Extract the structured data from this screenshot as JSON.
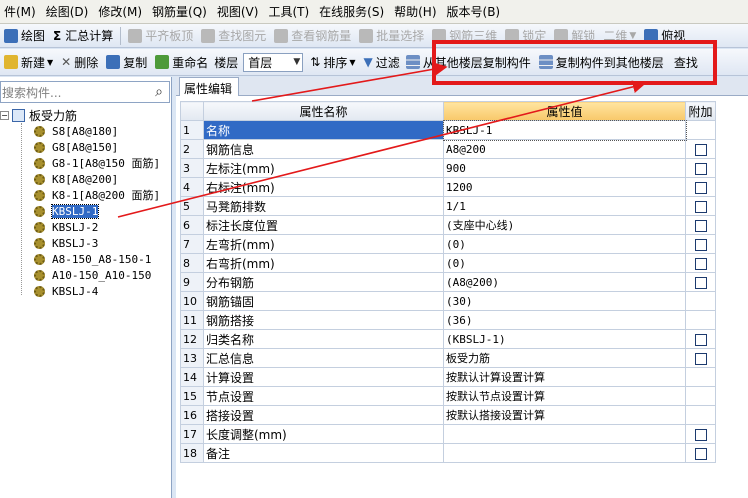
{
  "menu": [
    "件(M)",
    "绘图(D)",
    "修改(M)",
    "钢筋量(Q)",
    "视图(V)",
    "工具(T)",
    "在线服务(S)",
    "帮助(H)",
    "版本号(B)"
  ],
  "toolbar1": {
    "draw": "绘图",
    "sum_calc": "汇总计算",
    "flat_board": "平齐板顶",
    "find_element": "查找图元",
    "view_rebar": "查看钢筋量",
    "batch_select": "批量选择",
    "rebar_3d": "钢筋三维",
    "lock": "锁定",
    "unlock": "解锁",
    "view_mode": "二维",
    "perspective": "俯视"
  },
  "toolbar2": {
    "new": "新建",
    "delete": "删除",
    "copy": "复制",
    "rename": "重命名",
    "floor_label": "楼层",
    "floor_value": "首层",
    "sort": "排序",
    "filter": "过滤",
    "copy_from_floor": "从其他楼层复制构件",
    "copy_to_floor": "复制构件到其他楼层",
    "find": "查找"
  },
  "left_panel": {
    "search_placeholder": "搜索构件...",
    "root_label": "板受力筋",
    "items": [
      {
        "label": "S8[A8@180]",
        "selected": false
      },
      {
        "label": "G8[A8@150]",
        "selected": false
      },
      {
        "label": "G8-1[A8@150 面筋]",
        "selected": false
      },
      {
        "label": "K8[A8@200]",
        "selected": false
      },
      {
        "label": "K8-1[A8@200 面筋]",
        "selected": false
      },
      {
        "label": "KBSLJ-1",
        "selected": true
      },
      {
        "label": "KBSLJ-2",
        "selected": false
      },
      {
        "label": "KBSLJ-3",
        "selected": false
      },
      {
        "label": "A8-150_A8-150-1",
        "selected": false
      },
      {
        "label": "A10-150_A10-150",
        "selected": false
      },
      {
        "label": "KBSLJ-4",
        "selected": false
      }
    ]
  },
  "property_panel": {
    "tab": "属性编辑",
    "headers": [
      "属性名称",
      "属性值",
      "附加"
    ],
    "rows": [
      {
        "num": "1",
        "name": "名称",
        "value": "KBSLJ-1",
        "checkbox": false,
        "selected": true
      },
      {
        "num": "2",
        "name": "钢筋信息",
        "value": "A8@200",
        "checkbox": true
      },
      {
        "num": "3",
        "name": "左标注(mm)",
        "value": "900",
        "checkbox": true
      },
      {
        "num": "4",
        "name": "右标注(mm)",
        "value": "1200",
        "checkbox": true
      },
      {
        "num": "5",
        "name": "马凳筋排数",
        "value": "1/1",
        "checkbox": true
      },
      {
        "num": "6",
        "name": "标注长度位置",
        "value": "(支座中心线)",
        "checkbox": true
      },
      {
        "num": "7",
        "name": "左弯折(mm)",
        "value": "(0)",
        "checkbox": true
      },
      {
        "num": "8",
        "name": "右弯折(mm)",
        "value": "(0)",
        "checkbox": true
      },
      {
        "num": "9",
        "name": "分布钢筋",
        "value": "(A8@200)",
        "checkbox": true
      },
      {
        "num": "10",
        "name": "钢筋锚固",
        "value": "(30)",
        "checkbox": false
      },
      {
        "num": "11",
        "name": "钢筋搭接",
        "value": "(36)",
        "checkbox": false
      },
      {
        "num": "12",
        "name": "归类名称",
        "value": "(KBSLJ-1)",
        "checkbox": true
      },
      {
        "num": "13",
        "name": "汇总信息",
        "value": "板受力筋",
        "checkbox": true
      },
      {
        "num": "14",
        "name": "计算设置",
        "value": "按默认计算设置计算",
        "checkbox": false
      },
      {
        "num": "15",
        "name": "节点设置",
        "value": "按默认节点设置计算",
        "checkbox": false
      },
      {
        "num": "16",
        "name": "搭接设置",
        "value": "按默认搭接设置计算",
        "checkbox": false
      },
      {
        "num": "17",
        "name": "长度调整(mm)",
        "value": "",
        "checkbox": true
      },
      {
        "num": "18",
        "name": "备注",
        "value": "",
        "checkbox": true
      }
    ]
  },
  "colors": {
    "annotation_red": "#e3191a",
    "selection_blue": "#316ac5",
    "header_highlight": "#f8c86a"
  }
}
